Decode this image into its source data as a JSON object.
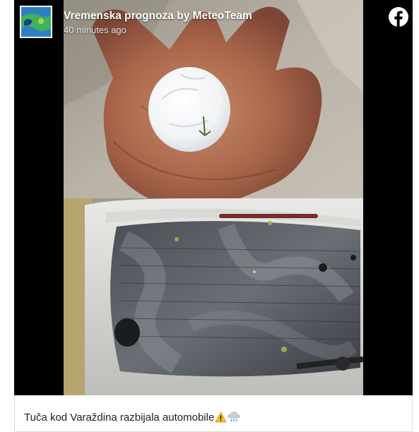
{
  "post": {
    "page_name": "Vremenska prognoza by MeteoTeam",
    "time": "40 minutes ago",
    "avatar_icon": "meteoteam-logo-icon",
    "platform_icon": "facebook-icon",
    "caption": "Tuča kod Varaždina razbijala automobile",
    "caption_emojis": [
      "warning-emoji-icon",
      "cloud-with-rain-emoji-icon"
    ]
  },
  "media": {
    "photos": [
      "hailstone-in-hand-photo",
      "shattered-car-rear-window-photo"
    ]
  },
  "colors": {
    "media_background": "#000000",
    "facebook_blue": "#1877f2",
    "caption_text": "#1c1e21",
    "border": "#dddfe2"
  }
}
